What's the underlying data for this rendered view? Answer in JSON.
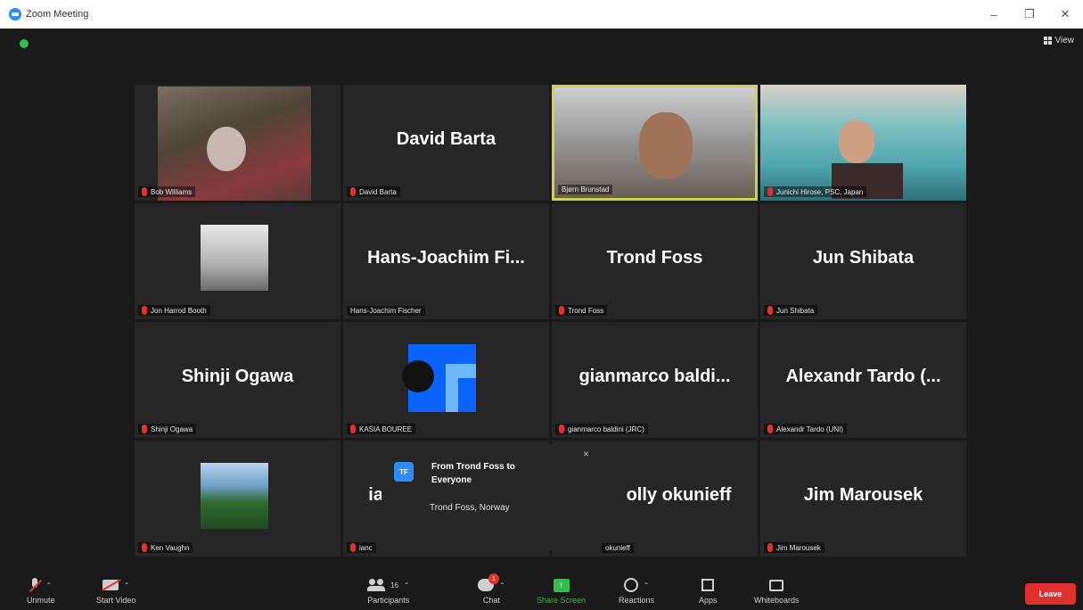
{
  "window": {
    "title": "Zoom Meeting",
    "minimize": "–",
    "restore": "❐",
    "close": "✕"
  },
  "header": {
    "view_label": "View"
  },
  "tiles": [
    {
      "big_name": "",
      "name_tag": "Bob Williams"
    },
    {
      "big_name": "David Barta",
      "name_tag": "David Barta"
    },
    {
      "big_name": "",
      "name_tag": "Bjørn Brunstad"
    },
    {
      "big_name": "",
      "name_tag": "Junichi Hirose, PSC, Japan"
    },
    {
      "big_name": "",
      "name_tag": "Jon Harrod Booth"
    },
    {
      "big_name": "Hans-Joachim  Fi...",
      "name_tag": "Hans-Joachim Fischer"
    },
    {
      "big_name": "Trond Foss",
      "name_tag": "Trond Foss"
    },
    {
      "big_name": "Jun Shibata",
      "name_tag": "Jun Shibata"
    },
    {
      "big_name": "Shinji Ogawa",
      "name_tag": "Shinji Ogawa"
    },
    {
      "big_name": "",
      "name_tag": "KASIA BOUREE"
    },
    {
      "big_name": "gianmarco  baldi...",
      "name_tag": "gianmarco baldini (JRC)"
    },
    {
      "big_name": "Alexandr  Tardo  (...",
      "name_tag": "Alexandr Tardo (UNI)"
    },
    {
      "big_name": "",
      "name_tag": "Ken Vaughn"
    },
    {
      "big_name": "iar",
      "name_tag": "ianc"
    },
    {
      "big_name": "olly okunieff",
      "name_tag": "okunieff"
    },
    {
      "big_name": "Jim Marousek",
      "name_tag": "Jim Marousek"
    }
  ],
  "chat_popup": {
    "avatar_initials": "TF",
    "from": "From Trond Foss to Everyone",
    "message": "Trond Foss, Norway",
    "close": "×"
  },
  "toolbar": {
    "unmute": "Unmute",
    "start_video": "Start Video",
    "participants": "Participants",
    "participants_count": "16",
    "chat": "Chat",
    "chat_badge": "1",
    "share_screen": "Share Screen",
    "reactions": "Reactions",
    "apps": "Apps",
    "whiteboards": "Whiteboards",
    "leave": "Leave"
  },
  "colors": {
    "active_speaker": "#c7d64a",
    "leave": "#e0302f",
    "share": "#2fbf4a",
    "accent": "#2d8cff"
  }
}
